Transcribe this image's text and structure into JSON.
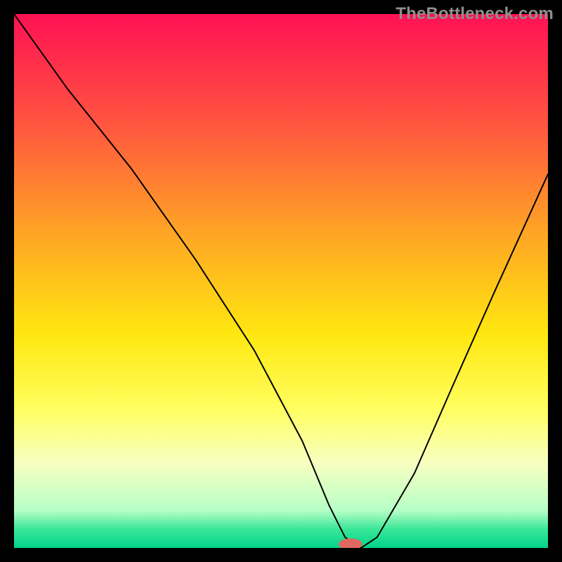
{
  "watermark": "TheBottleneck.com",
  "chart_data": {
    "type": "line",
    "title": "",
    "xlabel": "",
    "ylabel": "",
    "xlim": [
      0,
      100
    ],
    "ylim": [
      0,
      100
    ],
    "background": {
      "description": "vertical gradient red→orange→yellow→pale→green",
      "stops": [
        {
          "offset": 0.0,
          "color": "#ff1154"
        },
        {
          "offset": 0.2,
          "color": "#ff5340"
        },
        {
          "offset": 0.4,
          "color": "#ffa126"
        },
        {
          "offset": 0.6,
          "color": "#ffe710"
        },
        {
          "offset": 0.74,
          "color": "#ffff60"
        },
        {
          "offset": 0.84,
          "color": "#f8ffc0"
        },
        {
          "offset": 0.93,
          "color": "#b6ffc6"
        },
        {
          "offset": 0.965,
          "color": "#39e698"
        },
        {
          "offset": 1.0,
          "color": "#00d58b"
        }
      ]
    },
    "series": [
      {
        "name": "bottleneck-curve",
        "x": [
          0,
          10,
          22,
          34,
          45,
          54,
          59,
          62,
          65,
          68,
          75,
          82,
          90,
          100
        ],
        "y": [
          100,
          86,
          71,
          54,
          37,
          20,
          8,
          2,
          0,
          2,
          14,
          30,
          48,
          70
        ]
      }
    ],
    "marker": {
      "name": "optimal-point",
      "x": 63,
      "y": 0.7,
      "color": "#e0695f",
      "rx": 2.2,
      "ry": 1.1
    }
  }
}
